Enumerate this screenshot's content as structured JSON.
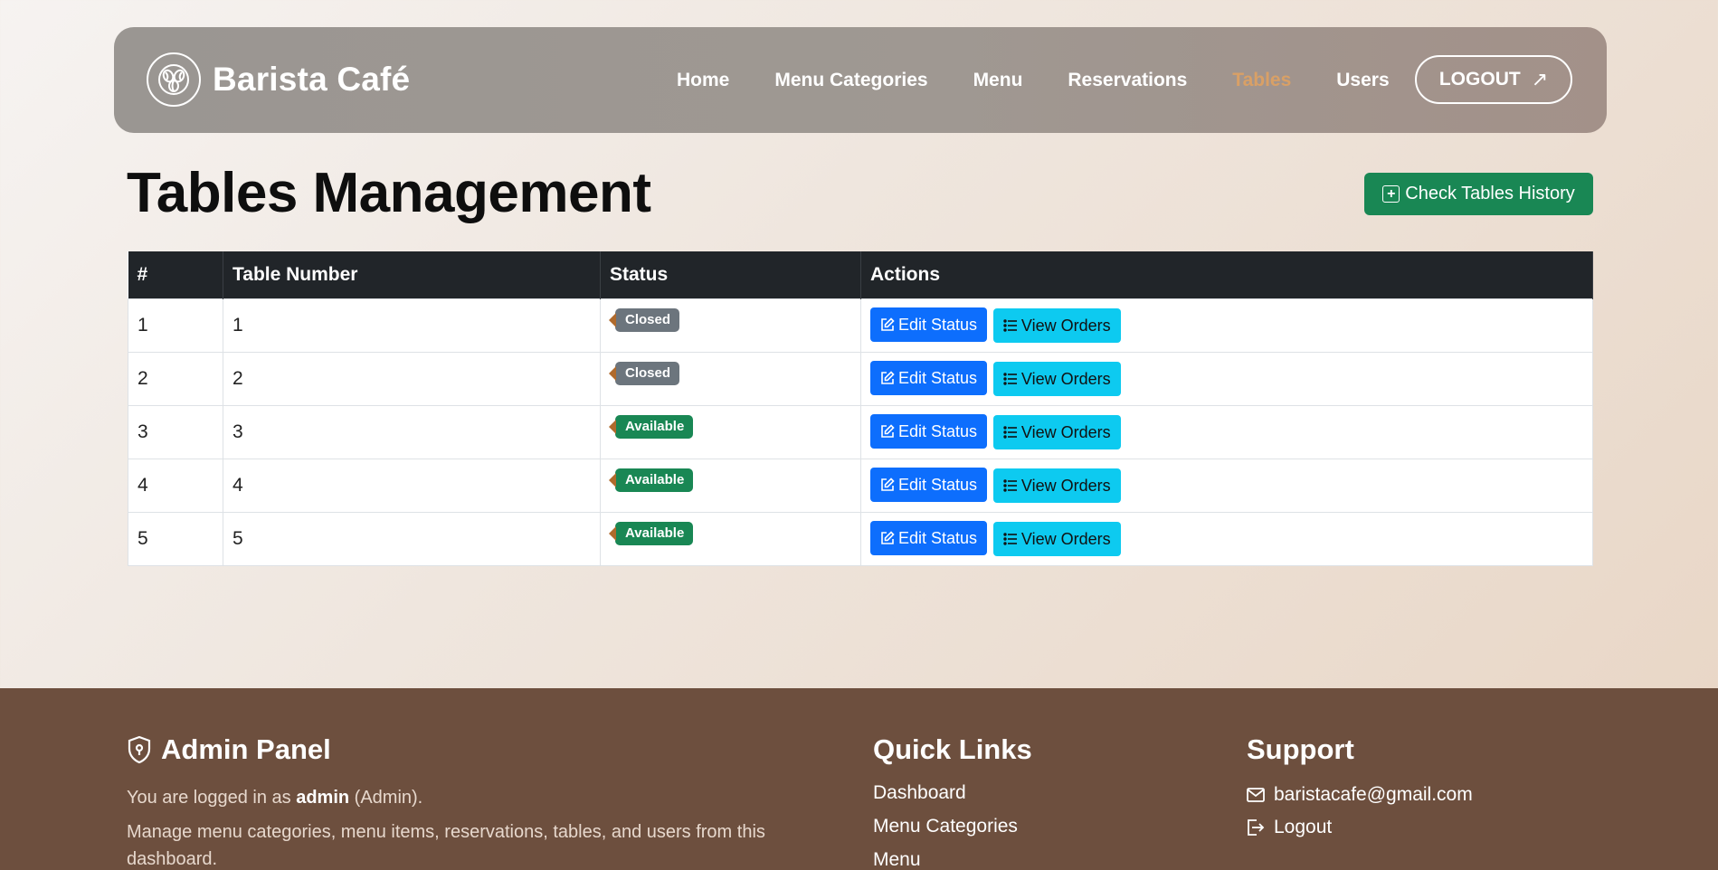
{
  "brand": {
    "name": "Barista Café"
  },
  "nav": {
    "items": [
      {
        "label": "Home",
        "active": false
      },
      {
        "label": "Menu Categories",
        "active": false
      },
      {
        "label": "Menu",
        "active": false
      },
      {
        "label": "Reservations",
        "active": false
      },
      {
        "label": "Tables",
        "active": true
      },
      {
        "label": "Users",
        "active": false
      }
    ],
    "logout_label": "LOGOUT"
  },
  "page": {
    "title": "Tables Management",
    "history_button": "Check Tables History"
  },
  "table": {
    "headers": [
      "#",
      "Table Number",
      "Status",
      "Actions"
    ],
    "rows": [
      {
        "index": "1",
        "number": "1",
        "status": "Closed"
      },
      {
        "index": "2",
        "number": "2",
        "status": "Closed"
      },
      {
        "index": "3",
        "number": "3",
        "status": "Available"
      },
      {
        "index": "4",
        "number": "4",
        "status": "Available"
      },
      {
        "index": "5",
        "number": "5",
        "status": "Available"
      }
    ],
    "edit_label": "Edit Status",
    "view_label": "View Orders"
  },
  "footer": {
    "admin_title": "Admin Panel",
    "login_prefix": "You are logged in as",
    "login_user": "admin",
    "login_role": "(Admin).",
    "description": "Manage menu categories, menu items, reservations, tables, and users from this dashboard.",
    "quick_links_title": "Quick Links",
    "quick_links": [
      "Dashboard",
      "Menu Categories",
      "Menu"
    ],
    "support_title": "Support",
    "support_email": "baristacafe@gmail.com",
    "support_logout": "Logout"
  },
  "colors": {
    "nav_active": "#d9a066",
    "primary": "#0d6efd",
    "info": "#0dcaf0",
    "success": "#198754",
    "secondary": "#6c757d",
    "footer_bg": "#6d4f3e"
  }
}
